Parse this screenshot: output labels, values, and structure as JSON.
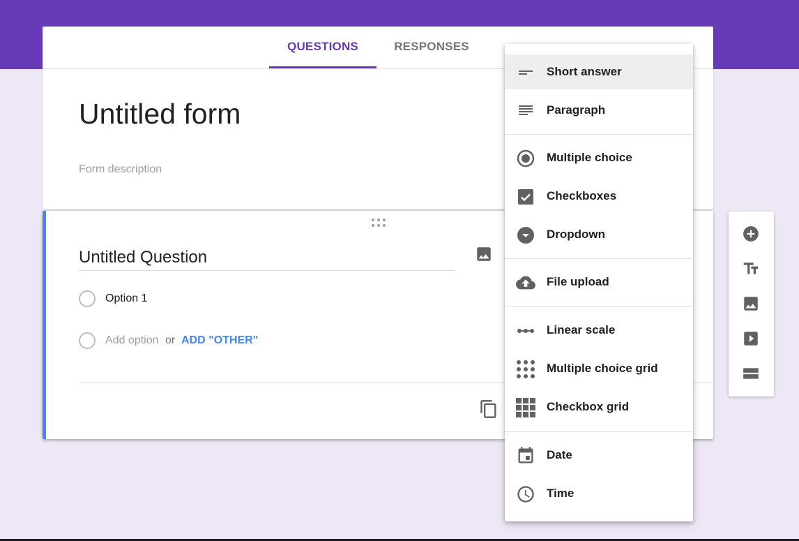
{
  "colors": {
    "brand": "#673ab7",
    "accent": "#4285f4",
    "background": "#ede7f6",
    "icon": "#616161"
  },
  "tabs": {
    "questions": "QUESTIONS",
    "responses": "RESPONSES",
    "active": "QUESTIONS"
  },
  "form": {
    "title": "Untitled form",
    "description_placeholder": "Form description"
  },
  "question": {
    "title": "Untitled Question",
    "options": [
      "Option 1"
    ],
    "add_option": "Add option",
    "or_text": "or",
    "add_other": "ADD \"OTHER\""
  },
  "icons": {
    "drag": "drag-handle-icon",
    "question_image": "image-icon",
    "duplicate": "copy-icon"
  },
  "side_toolbar": [
    {
      "name": "add-question",
      "icon": "add-circle-icon"
    },
    {
      "name": "add-title",
      "icon": "title-icon"
    },
    {
      "name": "add-image",
      "icon": "image-icon"
    },
    {
      "name": "add-video",
      "icon": "video-icon"
    },
    {
      "name": "add-section",
      "icon": "section-icon"
    }
  ],
  "type_menu": {
    "selected": "Short answer",
    "groups": [
      [
        {
          "label": "Short answer",
          "icon": "short-answer-icon"
        },
        {
          "label": "Paragraph",
          "icon": "paragraph-icon"
        }
      ],
      [
        {
          "label": "Multiple choice",
          "icon": "radio-icon"
        },
        {
          "label": "Checkboxes",
          "icon": "checkbox-icon"
        },
        {
          "label": "Dropdown",
          "icon": "dropdown-icon"
        }
      ],
      [
        {
          "label": "File upload",
          "icon": "cloud-upload-icon"
        }
      ],
      [
        {
          "label": "Linear scale",
          "icon": "linear-scale-icon"
        },
        {
          "label": "Multiple choice grid",
          "icon": "dot-grid-icon"
        },
        {
          "label": "Checkbox grid",
          "icon": "square-grid-icon"
        }
      ],
      [
        {
          "label": "Date",
          "icon": "calendar-icon"
        },
        {
          "label": "Time",
          "icon": "clock-icon"
        }
      ]
    ]
  }
}
